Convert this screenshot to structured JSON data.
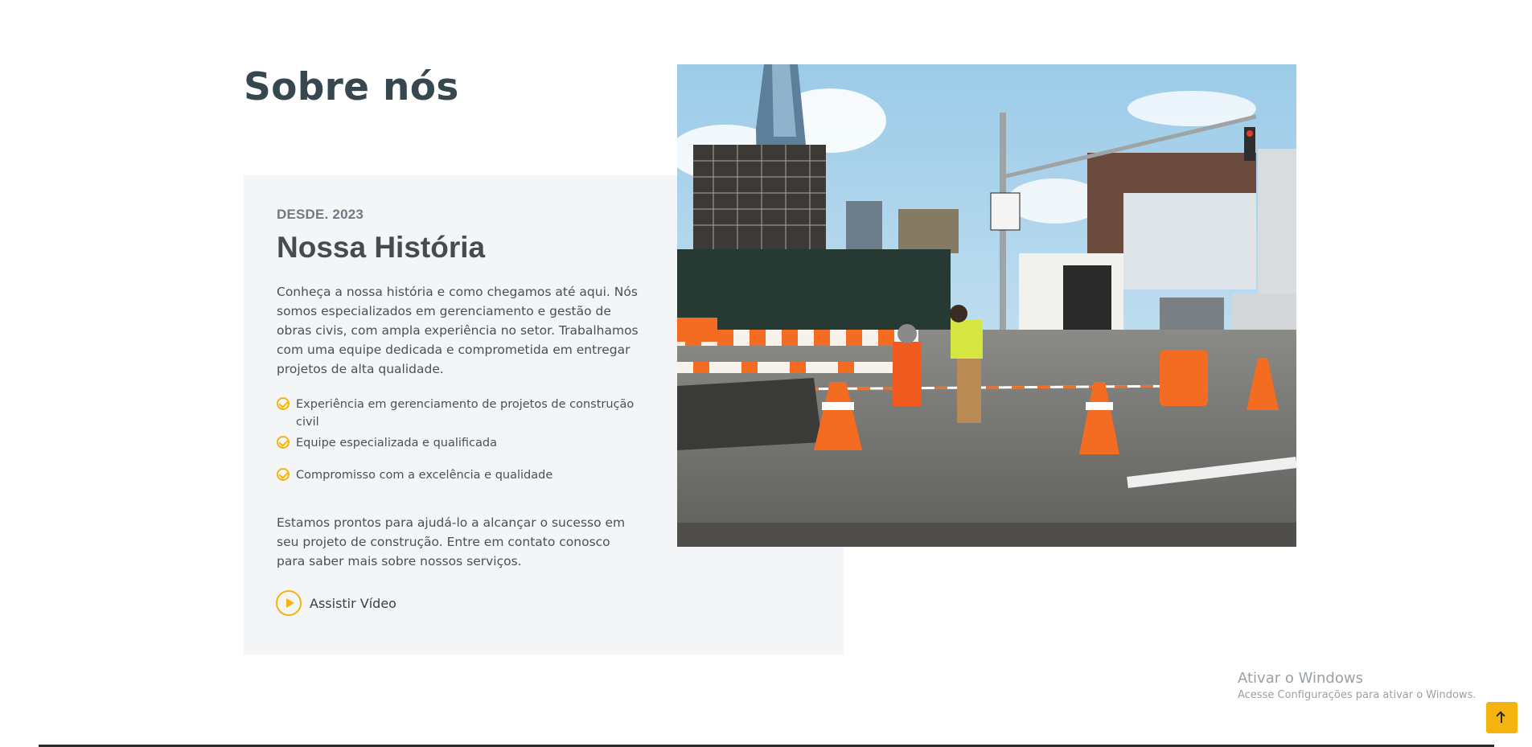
{
  "about": {
    "section_title": "Sobre nós",
    "since": "DESDE. 2023",
    "story_title": "Nossa História",
    "paragraph_1": "Conheça a nossa história e como chegamos até aqui. Nós somos especializados em gerenciamento e gestão de obras civis, com ampla experiência no setor. Trabalhamos com uma equipe dedicada e comprometida em entregar projetos de alta qualidade.",
    "features": [
      "Experiência em gerenciamento de projetos de construção civil",
      "Equipe especializada e qualificada",
      "Compromisso com a excelência e qualidade"
    ],
    "paragraph_2": "Estamos prontos para ajudá-lo a alcançar o sucesso em seu projeto de construção. Entre em contato conosco para saber mais sobre nossos serviços.",
    "video_label": "Assistir Vídeo"
  },
  "image": {
    "icon": "construction-site-photo"
  },
  "windows_watermark": {
    "title": "Ativar o Windows",
    "subtitle": "Acesse Configurações para ativar o Windows."
  },
  "back_to_top": {
    "icon": "arrow-up-icon"
  },
  "colors": {
    "accent": "#f5b30f",
    "heading": "#37474f",
    "box_background": "#f4f5f6",
    "text": "#4a5058"
  }
}
